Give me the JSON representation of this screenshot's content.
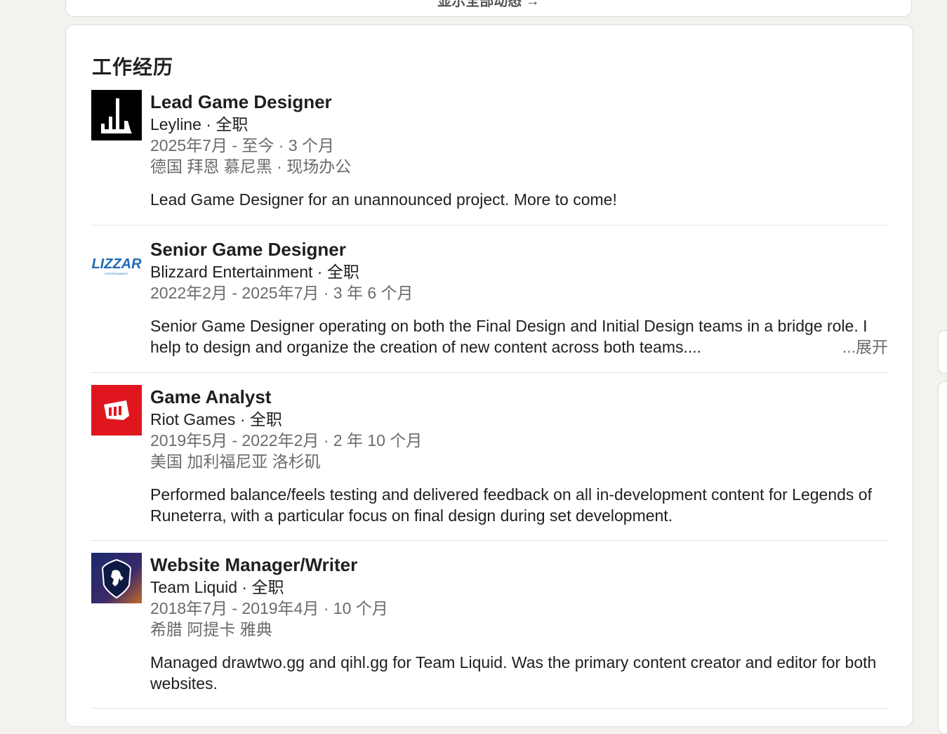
{
  "top_card": {
    "show_all_label": "显示全部动态 →"
  },
  "experience": {
    "title": "工作经历",
    "entries": [
      {
        "title": "Lead Game Designer",
        "company": "Leyline · 全职",
        "dates": "2025年7月 - 至今 · 3 个月",
        "location": "德国 拜恩 慕尼黑 · 现场办公",
        "description": "Lead Game Designer for an unannounced project. More to come!",
        "logo_icon": "leyline-logo-icon"
      },
      {
        "title": "Senior Game Designer",
        "company": "Blizzard Entertainment · 全职",
        "dates": "2022年2月 - 2025年7月 · 3 年 6 个月",
        "location": "",
        "description": "Senior Game Designer operating on both the Final Design and Initial Design teams in a bridge role. I help to design and organize the creation of new content across both teams....",
        "expand_label": "...展开",
        "logo_text": "BLIZZARD",
        "logo_subtext": "ENTERTAINMENT",
        "logo_color": "#1f6bb5"
      },
      {
        "title": "Game Analyst",
        "company": "Riot Games · 全职",
        "dates": "2019年5月 - 2022年2月 · 2 年 10 个月",
        "location": "美国 加利福尼亚 洛杉矶",
        "description": "Performed balance/feels testing and delivered feedback on all in-development content for Legends of Runeterra, with a particular focus on final design during set development.",
        "logo_icon": "riot-fist-icon",
        "logo_color": "#e0161f"
      },
      {
        "title": "Website Manager/Writer",
        "company": "Team Liquid · 全职",
        "dates": "2018年7月 - 2019年4月 · 10 个月",
        "location": "希腊 阿提卡 雅典",
        "description": "Managed drawtwo.gg and qihl.gg for Team Liquid. Was the primary content creator and editor for both websites.",
        "logo_icon": "team-liquid-horse-icon"
      }
    ]
  }
}
